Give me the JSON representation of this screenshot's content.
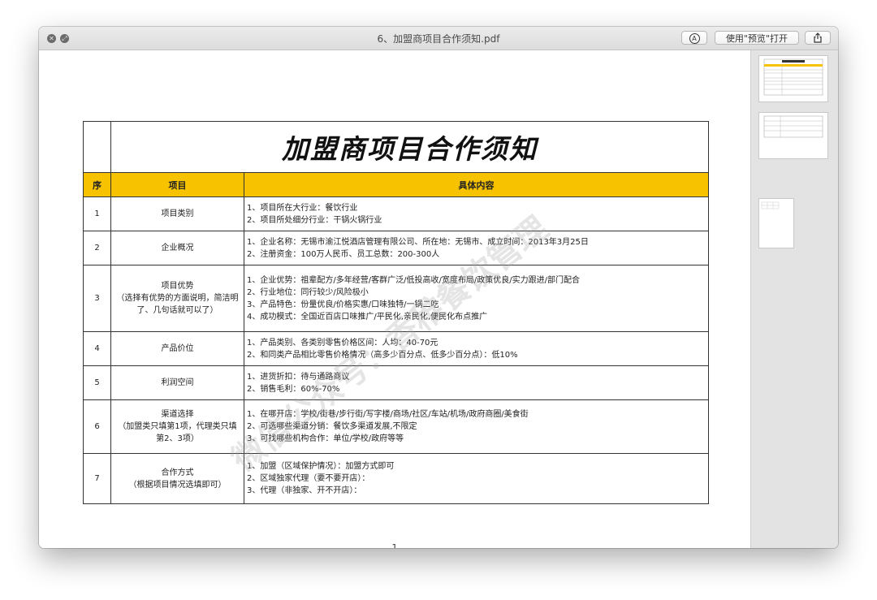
{
  "window": {
    "title": "6、加盟商项目合作须知.pdf",
    "markup_icon": "Ⓐ",
    "open_button": "使用\"预览\"打开",
    "share_icon": "share-icon"
  },
  "document": {
    "title": "加盟商项目合作须知",
    "headers": {
      "num": "序",
      "item": "项目",
      "content": "具体内容"
    },
    "rows": [
      {
        "num": "1",
        "item": "项目类别",
        "sub": "",
        "lines": [
          "1、项目所在大行业：餐饮行业",
          "2、项目所处细分行业：干锅火锅行业"
        ]
      },
      {
        "num": "2",
        "item": "企业概况",
        "sub": "",
        "lines": [
          "1、企业名称：无锡市渝江悦酒店管理有限公司、所在地：无锡市、成立时间：2013年3月25日",
          "2、注册资金：100万人民币、员工总数：200-300人"
        ]
      },
      {
        "num": "3",
        "item": "项目优势",
        "sub": "（选择有优势的方面说明，简洁明了、几句话就可以了）",
        "lines": [
          "1、企业优势：祖辈配方/多年经营/客群广泛/低投高收/宽度布局/政策优良/实力跟进/部门配合",
          "2、行业地位：同行较少/风险极小",
          "3、产品特色：份量优良/价格实惠/口味独特/一锅二吃",
          "4、成功模式：全国近百店口味推广/平民化,亲民化,便民化布点推广"
        ]
      },
      {
        "num": "4",
        "item": "产品价位",
        "sub": "",
        "lines": [
          "1、产品类别、各类别零售价格区间：人均：40-70元",
          "2、和同类产品相比零售价格情况（高多少百分点、低多少百分点）：低10%"
        ]
      },
      {
        "num": "5",
        "item": "利润空间",
        "sub": "",
        "lines": [
          "1、进货折扣：待与通路商议",
          "2、销售毛利：60%-70%"
        ]
      },
      {
        "num": "6",
        "item": "渠道选择",
        "sub": "（加盟类只填第1项，代理类只填第2、3项）",
        "lines": [
          "1、在哪开店：学校/街巷/步行街/写字楼/商场/社区/车站/机场/政府商圈/美食街",
          "2、可选哪些渠道分销：餐饮多渠道发展,不限定",
          "3、可找哪些机构合作：单位/学校/政府等等"
        ]
      },
      {
        "num": "7",
        "item": "合作方式",
        "sub": "（根据项目情况选填即可）",
        "lines": [
          "1、加盟（区域保护情况）：加盟方式即可",
          "2、区域独家代理（要不要开店）：",
          "3、代理（非独家、开不开店）："
        ]
      }
    ],
    "page_number": "1",
    "watermark": "微信公众号：香稚餐饮管理"
  }
}
